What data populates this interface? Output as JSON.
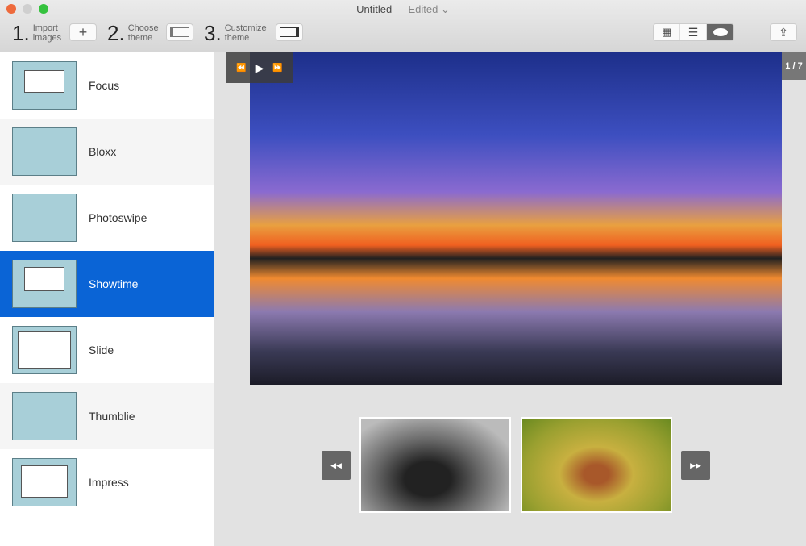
{
  "window": {
    "title": "Untitled",
    "status": "— Edited ⌄"
  },
  "toolbar": {
    "steps": [
      {
        "num": "1.",
        "line1": "Import",
        "line2": "images"
      },
      {
        "num": "2.",
        "line1": "Choose",
        "line2": "theme"
      },
      {
        "num": "3.",
        "line1": "Customize",
        "line2": "theme"
      }
    ],
    "add_label": "+",
    "views": [
      "grid-icon",
      "list-icon",
      "eye-icon"
    ],
    "active_view": "eye-icon"
  },
  "sidebar": {
    "items": [
      {
        "label": "Focus"
      },
      {
        "label": "Bloxx"
      },
      {
        "label": "Photoswipe"
      },
      {
        "label": "Showtime",
        "selected": true
      },
      {
        "label": "Slide"
      },
      {
        "label": "Thumblie"
      },
      {
        "label": "Impress"
      }
    ]
  },
  "preview": {
    "counter": "1 / 7",
    "rewind": "⏪",
    "play": "▶",
    "forward": "⏩",
    "prev": "◀◀",
    "next": "▶▶"
  },
  "colors": {
    "accent": "#0a64d6"
  }
}
